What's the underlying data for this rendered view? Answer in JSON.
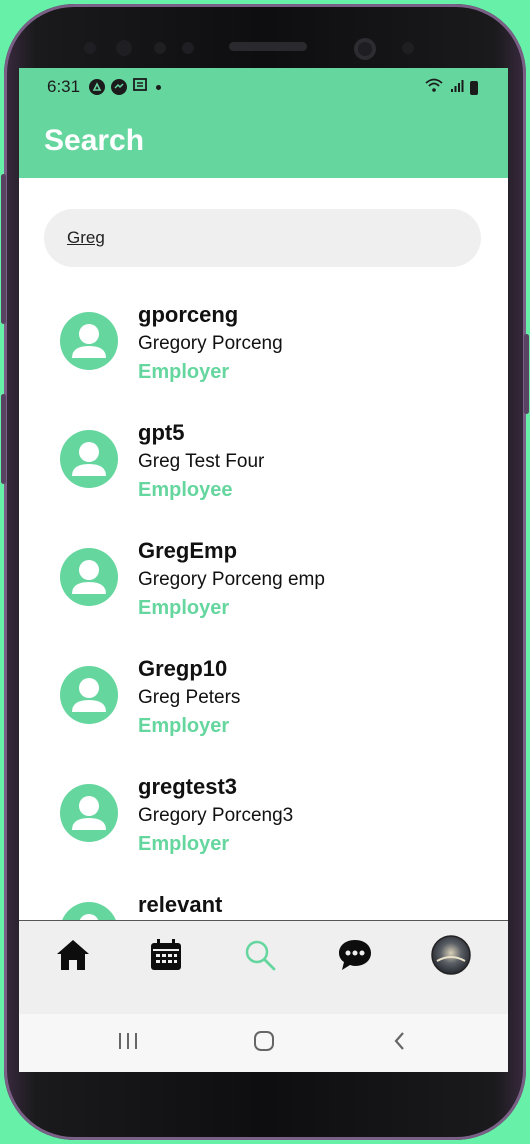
{
  "status_bar": {
    "time": "6:31",
    "left_icons": [
      "maps-icon",
      "messenger-icon",
      "news-icon",
      "dot-icon"
    ],
    "right_icons": [
      "wifi-icon",
      "signal-icon",
      "battery-icon"
    ]
  },
  "app_bar": {
    "title": "Search"
  },
  "search": {
    "value": "Greg"
  },
  "colors": {
    "accent": "#66d69f",
    "text": "#111111",
    "search_bg": "#efefef"
  },
  "results": [
    {
      "username": "gporceng",
      "full_name": "Gregory Porceng",
      "role": "Employer"
    },
    {
      "username": "gpt5",
      "full_name": "Greg Test Four",
      "role": "Employee"
    },
    {
      "username": "GregEmp",
      "full_name": "Gregory Porceng emp",
      "role": "Employer"
    },
    {
      "username": "Gregp10",
      "full_name": "Greg Peters",
      "role": "Employer"
    },
    {
      "username": "gregtest3",
      "full_name": "Gregory Porceng3",
      "role": "Employer"
    },
    {
      "username": "relevant"
    }
  ],
  "bottom_nav": {
    "items": [
      {
        "icon": "home-icon",
        "active": false
      },
      {
        "icon": "calendar-icon",
        "active": false
      },
      {
        "icon": "search-icon",
        "active": true
      },
      {
        "icon": "chat-icon",
        "active": false
      },
      {
        "icon": "profile-avatar",
        "active": false
      }
    ]
  },
  "system_nav": {
    "items": [
      "recents-icon",
      "home-circle-icon",
      "back-icon"
    ]
  }
}
